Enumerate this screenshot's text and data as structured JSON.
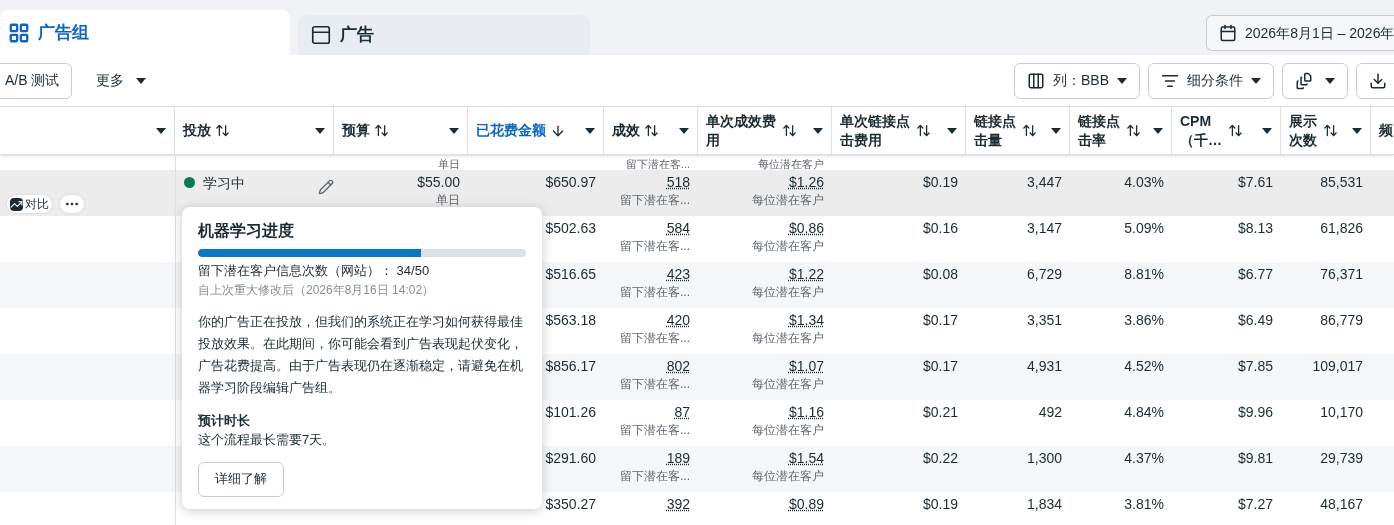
{
  "tabs": [
    {
      "label": "广告组",
      "selected": true,
      "kind": "adsets"
    },
    {
      "label": "广告",
      "selected": false,
      "kind": "ads"
    }
  ],
  "date_range": "2026年8月1日 – 2026年",
  "toolbar": {
    "ab_test": "A/B 测试",
    "more": "更多",
    "columns": "列：BBB",
    "breakdown": "细分条件"
  },
  "columns": [
    {},
    {
      "label": "投放",
      "sortable": true,
      "sorted": false
    },
    {
      "label": "预算",
      "sortable": true,
      "sorted": false
    },
    {
      "label": "已花费金额",
      "sortable": true,
      "sorted": true
    },
    {
      "label": "成效",
      "sortable": true,
      "sorted": false
    },
    {
      "label": "单次成效费用",
      "sortable": true,
      "sorted": false
    },
    {
      "label": "单次链接点击费用",
      "sortable": true,
      "sorted": false
    },
    {
      "label": "链接点击量",
      "sortable": true,
      "sorted": false
    },
    {
      "label": "链接点击率",
      "sortable": true,
      "sorted": false
    },
    {
      "label": "CPM（千…",
      "sortable": true,
      "sorted": false
    },
    {
      "label": "展示次数",
      "sortable": true,
      "sorted": false
    },
    {
      "label": "频"
    }
  ],
  "partial_row": {
    "budget_period": "单日",
    "results_label": "留下潜在客...",
    "cost_label": "每位潜在客户"
  },
  "rows": [
    {
      "highlighted": true,
      "compare": "对比",
      "status": {
        "label": "学习中",
        "color": "#0a7a55"
      },
      "budget": "$55.00",
      "budget_period": "单日",
      "spent": "$650.97",
      "results": "518",
      "results_label": "留下潜在客...",
      "cost": "$1.26",
      "cost_label": "每位潜在客户",
      "cpc": "$0.19",
      "clicks": "3,447",
      "ctr": "4.03%",
      "cpm": "$7.61",
      "impressions": "85,531"
    },
    {
      "spent": "$502.63",
      "results": "584",
      "results_label": "留下潜在客...",
      "cost": "$0.86",
      "cost_label": "每位潜在客户",
      "cpc": "$0.16",
      "clicks": "3,147",
      "ctr": "5.09%",
      "cpm": "$8.13",
      "impressions": "61,826"
    },
    {
      "spent": "$516.65",
      "results": "423",
      "results_label": "留下潜在客...",
      "cost": "$1.22",
      "cost_label": "每位潜在客户",
      "cpc": "$0.08",
      "clicks": "6,729",
      "ctr": "8.81%",
      "cpm": "$6.77",
      "impressions": "76,371"
    },
    {
      "spent": "$563.18",
      "results": "420",
      "results_label": "留下潜在客...",
      "cost": "$1.34",
      "cost_label": "每位潜在客户",
      "cpc": "$0.17",
      "clicks": "3,351",
      "ctr": "3.86%",
      "cpm": "$6.49",
      "impressions": "86,779"
    },
    {
      "spent": "$856.17",
      "results": "802",
      "results_label": "留下潜在客...",
      "cost": "$1.07",
      "cost_label": "每位潜在客户",
      "cpc": "$0.17",
      "clicks": "4,931",
      "ctr": "4.52%",
      "cpm": "$7.85",
      "impressions": "109,017"
    },
    {
      "spent": "$101.26",
      "results": "87",
      "results_label": "留下潜在客...",
      "cost": "$1.16",
      "cost_label": "每位潜在客户",
      "cpc": "$0.21",
      "clicks": "492",
      "ctr": "4.84%",
      "cpm": "$9.96",
      "impressions": "10,170"
    },
    {
      "spent": "$291.60",
      "results": "189",
      "results_label": "留下潜在客...",
      "cost": "$1.54",
      "cost_label": "每位潜在客户",
      "cpc": "$0.22",
      "clicks": "1,300",
      "ctr": "4.37%",
      "cpm": "$9.81",
      "impressions": "29,739"
    },
    {
      "spent": "$350.27",
      "results": "392",
      "cost": "$0.89",
      "cpc": "$0.19",
      "clicks": "1,834",
      "ctr": "3.81%",
      "cpm": "$7.27",
      "impressions": "48,167"
    }
  ],
  "popover": {
    "title": "机器学习进度",
    "level": 0.68,
    "count": "留下潜在客户信息次数（网站）： 34/50",
    "since": "自上次重大修改后（2026年8月16日 14:02）",
    "body": "你的广告正在投放，但我们的系统正在学习如何获得最佳投放效果。在此期间，你可能会看到广告表现起伏变化，广告花费提高。由于广告表现仍在逐渐稳定，请避免在机器学习阶段编辑广告组。",
    "duration_title": "预计时长",
    "duration": "这个流程最长需要7天。",
    "button": "详细了解"
  }
}
